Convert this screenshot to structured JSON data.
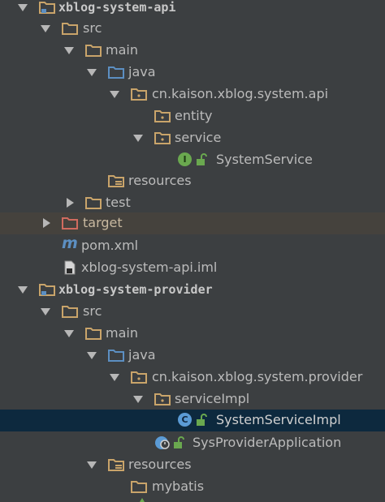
{
  "tree": {
    "rows": [
      {
        "label": "xblog-system-api"
      },
      {
        "label": "src"
      },
      {
        "label": "main"
      },
      {
        "label": "java"
      },
      {
        "label": "cn.kaison.xblog.system.api"
      },
      {
        "label": "entity"
      },
      {
        "label": "service"
      },
      {
        "label": "SystemService",
        "badge": "I"
      },
      {
        "label": "resources"
      },
      {
        "label": "test"
      },
      {
        "label": "target"
      },
      {
        "label": "pom.xml",
        "badge": "m"
      },
      {
        "label": "xblog-system-api.iml"
      },
      {
        "label": "xblog-system-provider"
      },
      {
        "label": "src"
      },
      {
        "label": "main"
      },
      {
        "label": "java"
      },
      {
        "label": "cn.kaison.xblog.system.provider"
      },
      {
        "label": "serviceImpl"
      },
      {
        "label": "SystemServiceImpl",
        "badge": "C"
      },
      {
        "label": "SysProviderApplication"
      },
      {
        "label": "resources"
      },
      {
        "label": "mybatis"
      }
    ]
  },
  "colors": {
    "background": "#3c3f41",
    "selected_row": "#0d293e",
    "target_row": "#45423d",
    "folder": "#c9a46a",
    "source_folder": "#5c8fc2",
    "excluded_folder": "#d06b5f",
    "interface_badge": "#6aa84f",
    "class_badge": "#5b9bd5"
  }
}
